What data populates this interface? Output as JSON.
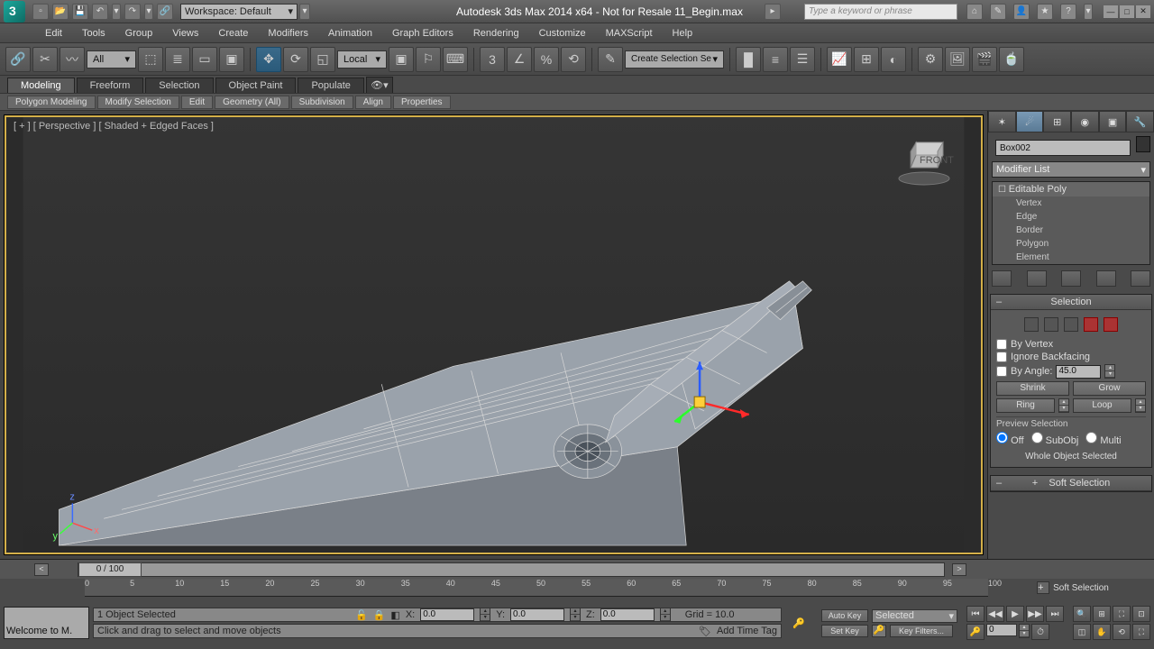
{
  "title": "Autodesk 3ds Max  2014 x64 - Not for Resale    11_Begin.max",
  "workspace_label": "Workspace: Default",
  "search_placeholder": "Type a keyword or phrase",
  "menu": [
    "Edit",
    "Tools",
    "Group",
    "Views",
    "Create",
    "Modifiers",
    "Animation",
    "Graph Editors",
    "Rendering",
    "Customize",
    "MAXScript",
    "Help"
  ],
  "selection_filter": "All",
  "ref_coord": "Local",
  "ribbon_tabs": [
    "Modeling",
    "Freeform",
    "Selection",
    "Object Paint",
    "Populate"
  ],
  "ribbon_sub": [
    "Polygon Modeling",
    "Modify Selection",
    "Edit",
    "Geometry (All)",
    "Subdivision",
    "Align",
    "Properties"
  ],
  "viewport_label": "[ + ] [ Perspective ] [ Shaded + Edged Faces ]",
  "cmd": {
    "object_name": "Box002",
    "modifier_combo": "Modifier List",
    "stack_root": "Editable Poly",
    "stack_subs": [
      "Vertex",
      "Edge",
      "Border",
      "Polygon",
      "Element"
    ]
  },
  "selection_rollout": {
    "title": "Selection",
    "by_vertex": "By Vertex",
    "ignore_backfacing": "Ignore Backfacing",
    "by_angle": "By Angle:",
    "angle_val": "45.0",
    "shrink": "Shrink",
    "grow": "Grow",
    "ring": "Ring",
    "loop": "Loop",
    "preview": "Preview Selection",
    "off": "Off",
    "subobj": "SubObj",
    "multi": "Multi",
    "status": "Whole Object Selected"
  },
  "soft_sel_title": "Soft Selection",
  "timeline": {
    "frame_label": "0 / 100",
    "ticks": [
      "0",
      "5",
      "10",
      "15",
      "20",
      "25",
      "30",
      "35",
      "40",
      "45",
      "50",
      "55",
      "60",
      "65",
      "70",
      "75",
      "80",
      "85",
      "90",
      "95",
      "100"
    ]
  },
  "status": {
    "welcome": "Welcome to M.",
    "sel_info": "1 Object Selected",
    "prompt": "Click and drag to select and move objects",
    "x": "0.0",
    "y": "0.0",
    "z": "0.0",
    "grid": "Grid = 10.0",
    "add_time_tag": "Add Time Tag",
    "auto_key": "Auto Key",
    "set_key": "Set Key",
    "kf_combo": "Selected",
    "key_filters": "Key Filters...",
    "frame_input": "0"
  }
}
